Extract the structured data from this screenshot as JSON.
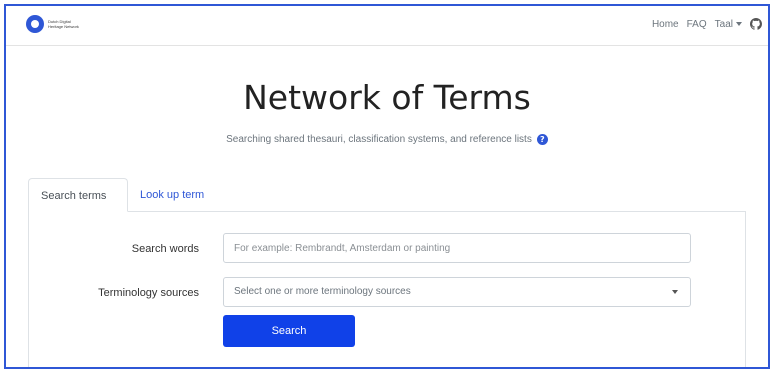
{
  "navbar": {
    "logo_text": "Dutch Digital Heritage Network",
    "links": [
      "Home",
      "FAQ"
    ],
    "language": "Taal",
    "github_icon": "github-icon"
  },
  "header": {
    "title": "Network of Terms",
    "subtitle": "Searching shared thesauri, classification systems, and reference lists",
    "info_icon": "info-icon"
  },
  "tabs": [
    {
      "label": "Search terms",
      "active": true
    },
    {
      "label": "Look up term",
      "active": false
    }
  ],
  "form": {
    "search_label": "Search words",
    "search_placeholder": "For example: Rembrandt, Amsterdam or painting",
    "sources_label": "Terminology sources",
    "sources_placeholder": "Select one or more terminology sources",
    "submit_label": "Search"
  },
  "colors": {
    "accent": "#2f57d6",
    "button": "#1041e8"
  }
}
